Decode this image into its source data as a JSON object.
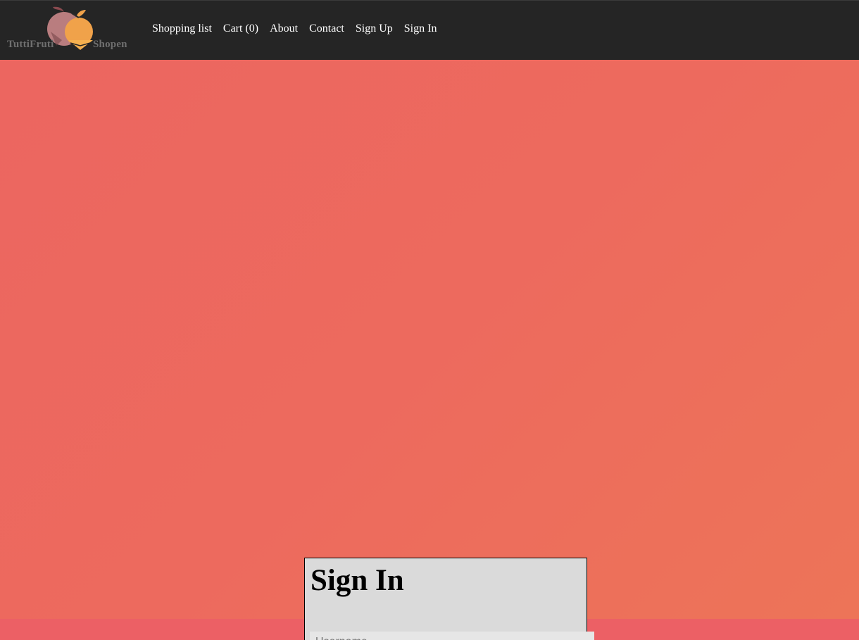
{
  "brand": {
    "logo_left": "TuttiFruti",
    "logo_right": "Shopen",
    "colors": {
      "fruit_pink": "#b97d7f",
      "fruit_orange": "#f0a24a"
    }
  },
  "nav": {
    "items": [
      {
        "label": "Shopping list"
      },
      {
        "label": "Cart (0)"
      },
      {
        "label": "About"
      },
      {
        "label": "Contact"
      },
      {
        "label": "Sign Up"
      },
      {
        "label": "Sign In"
      }
    ]
  },
  "signin": {
    "title": "Sign In",
    "username_placeholder": "Username"
  },
  "colors": {
    "topbar": "#252525",
    "hero_start": "#ec6660",
    "hero_end": "#ed7458",
    "panel": "#dadada"
  }
}
